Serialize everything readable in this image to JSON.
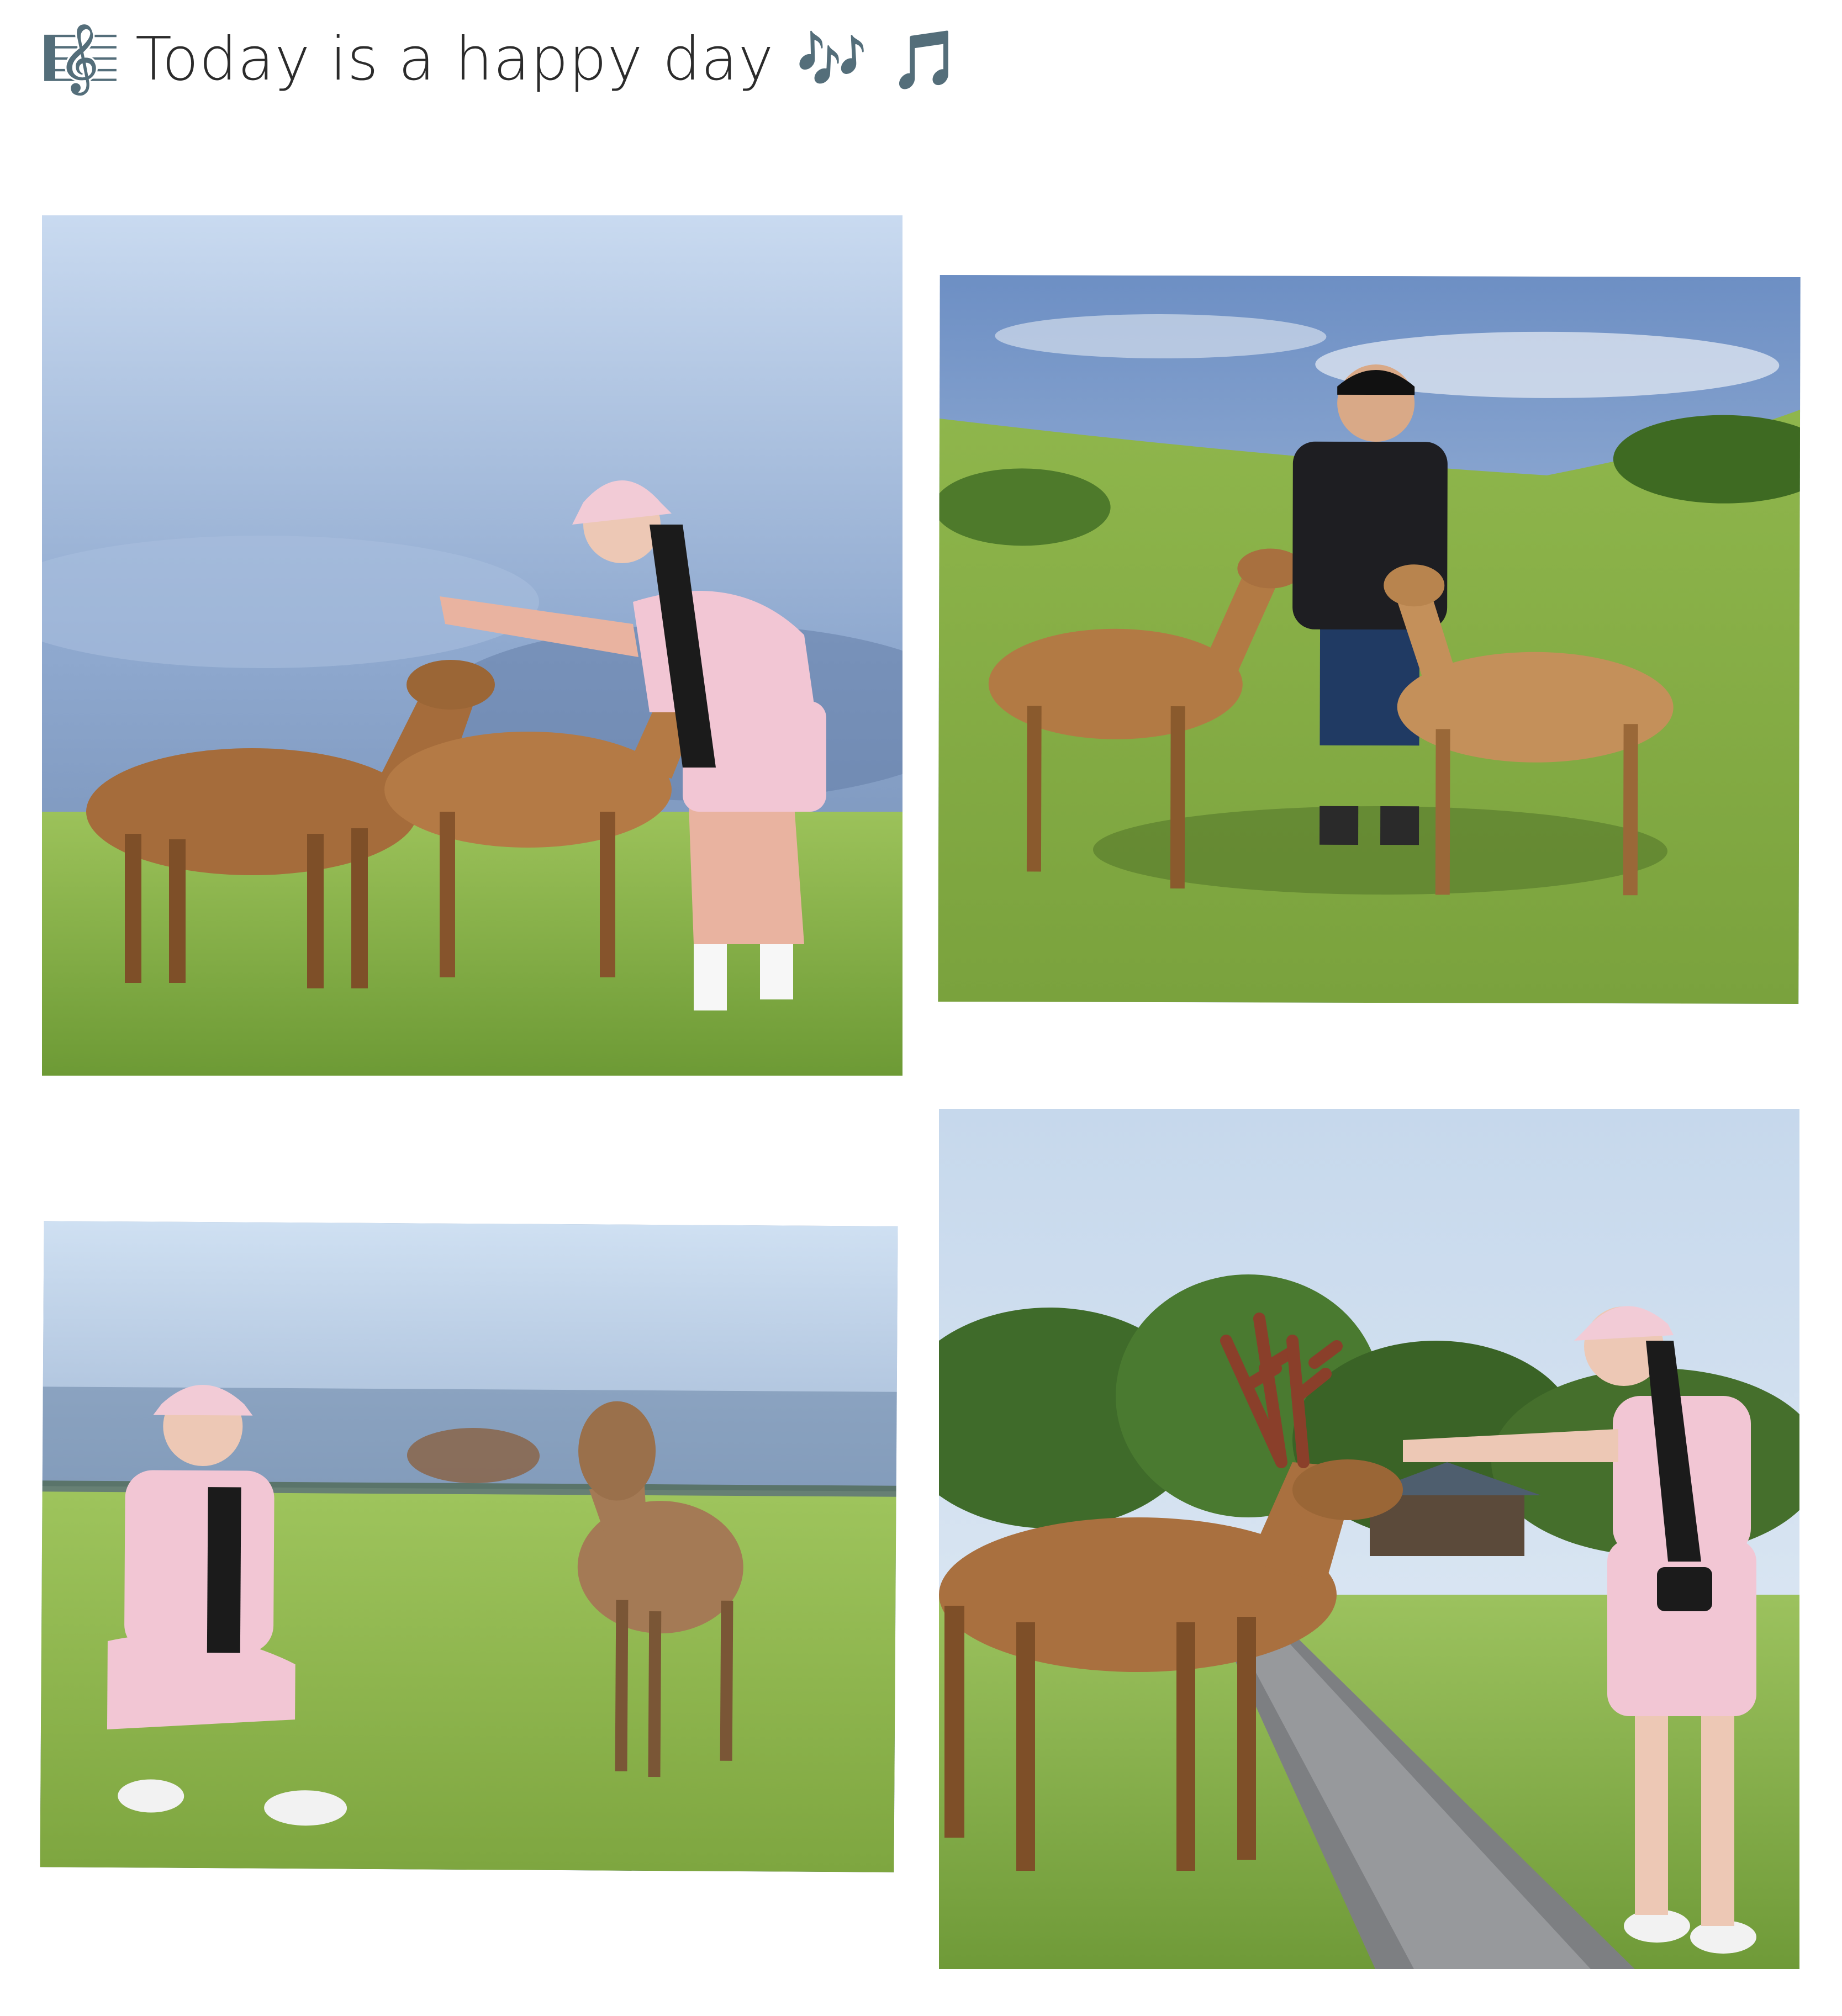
{
  "header": {
    "clef_icon": "🎼",
    "title": "Today is a happy day",
    "notes_icon_1": "🎶",
    "notes_icon_2": "🎵"
  },
  "photos": [
    {
      "id": "photo-1",
      "subject": "woman-petting-deer"
    },
    {
      "id": "photo-2",
      "subject": "man-with-two-deer"
    },
    {
      "id": "photo-3",
      "subject": "woman-posing-with-deer"
    },
    {
      "id": "photo-4",
      "subject": "woman-feeding-stag"
    }
  ],
  "colors": {
    "sky_blue": "#b9cde6",
    "haze_blue": "#7f9cc4",
    "grass_green": "#86b04a",
    "deer_brown": "#a8703f",
    "pink_outfit": "#f2c6d4",
    "dark_shirt": "#1e1e22"
  }
}
